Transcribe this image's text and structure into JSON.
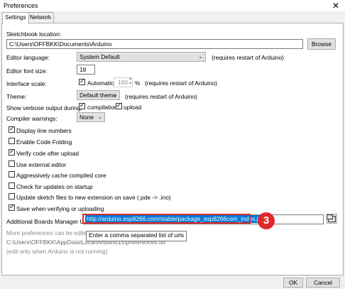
{
  "window": {
    "title": "Preferences",
    "close_glyph": "✕"
  },
  "tabs": [
    {
      "label": "Settings",
      "active": true
    },
    {
      "label": "Network",
      "active": false
    }
  ],
  "sketchbook": {
    "label": "Sketchbook location:",
    "value": "C:\\Users\\OFFBKK\\Documents\\Arduino",
    "browse_label": "Browse"
  },
  "editor_language": {
    "label": "Editor language:",
    "value": "System Default",
    "note": "(requires restart of Arduino)"
  },
  "font_size": {
    "label": "Editor font size:",
    "value": "18"
  },
  "interface_scale": {
    "label": "Interface scale:",
    "automatic_label": "Automatic",
    "automatic_checked": true,
    "value": "100",
    "unit": "%",
    "note": "(requires restart of Arduino)"
  },
  "theme": {
    "label": "Theme:",
    "value": "Default theme",
    "note": "(requires restart of Arduino)"
  },
  "verbose": {
    "label": "Show verbose output during:",
    "compilation_label": "compilation",
    "compilation_checked": true,
    "upload_label": "upload",
    "upload_checked": true
  },
  "compiler_warnings": {
    "label": "Compiler warnings:",
    "value": "None"
  },
  "options": [
    {
      "label": "Display line numbers",
      "checked": true
    },
    {
      "label": "Enable Code Folding",
      "checked": false
    },
    {
      "label": "Verify code after upload",
      "checked": true
    },
    {
      "label": "Use external editor",
      "checked": false
    },
    {
      "label": "Aggressively cache compiled core",
      "checked": false
    },
    {
      "label": "Check for updates on startup",
      "checked": false
    },
    {
      "label": "Update sketch files to new extension on save (.pde -> .ino)",
      "checked": false
    },
    {
      "label": "Save when verifying or uploading",
      "checked": true
    }
  ],
  "boards_manager": {
    "label": "Additional Boards Manager URLs:",
    "value": "http://arduino.esp8266.com/stable/package_esp8266com_index.json"
  },
  "tooltip": "Enter a comma separated list of urls",
  "step_badge": "3",
  "more_prefs": {
    "text_a": "More preferences can be edited di",
    "text_b": "e",
    "path": "C:\\Users\\OFFBKK\\AppData\\Local\\Arduino15\\preferences.txt",
    "note": "(edit only when Arduino is not running)"
  },
  "buttons": {
    "ok": "OK",
    "cancel": "Cancel"
  },
  "colors": {
    "selection": "#0078d7",
    "annotation_red": "#e0282a"
  }
}
